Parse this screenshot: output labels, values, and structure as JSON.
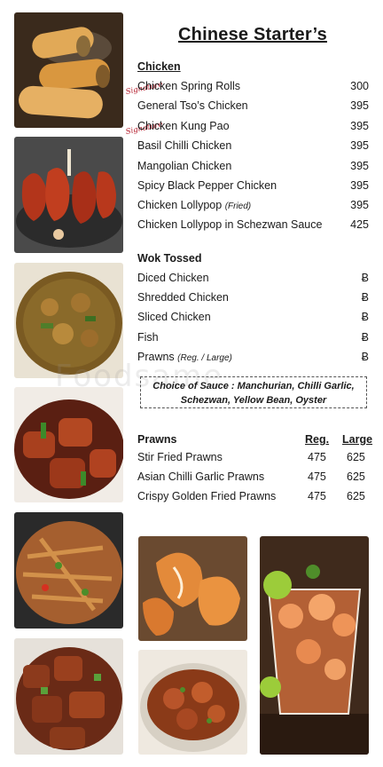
{
  "title": "Chinese Starter’s",
  "chicken": {
    "heading": "Chicken",
    "signature_label": "Signature",
    "items": [
      {
        "name": "Chicken Spring Rolls",
        "note": "",
        "price": "300"
      },
      {
        "name": "General Tso’s Chicken",
        "note": "",
        "price": "395"
      },
      {
        "name": "Chicken Kung Pao",
        "note": "",
        "price": "395"
      },
      {
        "name": "Basil Chilli Chicken",
        "note": "",
        "price": "395"
      },
      {
        "name": "Mangolian Chicken",
        "note": "",
        "price": "395"
      },
      {
        "name": "Spicy Black Pepper Chicken",
        "note": "",
        "price": "395"
      },
      {
        "name": "Chicken Lollypop",
        "note": "(Fried)",
        "price": "395"
      },
      {
        "name": "Chicken Lollypop in Schezwan Sauce",
        "note": "",
        "price": "425"
      }
    ]
  },
  "wok": {
    "heading": "Wok Tossed",
    "items": [
      {
        "name": "Diced Chicken",
        "note": "",
        "symbol": "Ƀ"
      },
      {
        "name": "Shredded Chicken",
        "note": "",
        "symbol": "Ƀ"
      },
      {
        "name": "Sliced Chicken",
        "note": "",
        "symbol": "Ƀ"
      },
      {
        "name": "Fish",
        "note": "",
        "symbol": "Ƀ"
      },
      {
        "name": "Prawns",
        "note": "(Reg. / Large)",
        "symbol": "Ƀ"
      }
    ],
    "sauce_line1": "Choice of Sauce : Manchurian, Chilli Garlic,",
    "sauce_line2": "Schezwan, Yellow Bean, Oyster"
  },
  "prawns": {
    "heading": "Prawns",
    "col_reg": "Reg.",
    "col_large": "Large",
    "items": [
      {
        "name": "Stir Fried Prawns",
        "reg": "475",
        "large": "625"
      },
      {
        "name": "Asian Chilli Garlic Prawns",
        "reg": "475",
        "large": "625"
      },
      {
        "name": "Crispy Golden Fried Prawns",
        "reg": "475",
        "large": "625"
      }
    ]
  },
  "watermark": "Foodsame"
}
